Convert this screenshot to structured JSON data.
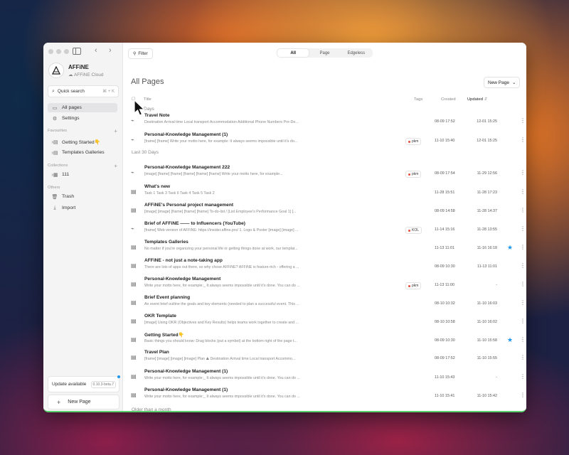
{
  "sidebar": {
    "workspace_name": "AFFiNE",
    "workspace_sub": "AFFiNE Cloud",
    "quick_search": "Quick search",
    "quick_search_kbd": "⌘ + K",
    "nav": [
      {
        "label": "All pages",
        "icon": "folder-icon"
      },
      {
        "label": "Settings",
        "icon": "gear-icon"
      }
    ],
    "favourites_label": "Favourites",
    "favourites": [
      "Getting Started👇",
      "Templates Galleries"
    ],
    "collections_label": "Collections",
    "collections": [
      "111"
    ],
    "others_label": "Others",
    "others": [
      {
        "label": "Trash",
        "icon": "trash-icon"
      },
      {
        "label": "Import",
        "icon": "import-icon"
      }
    ],
    "update_label": "Update available",
    "update_version": "0.10.3-beta.7",
    "new_page": "New Page"
  },
  "toolbar": {
    "filter": "Filter",
    "modes": [
      "All",
      "Page",
      "Edgeless"
    ],
    "active_mode": "All"
  },
  "main": {
    "title": "All Pages",
    "new_page_btn": "New Page",
    "columns": {
      "title": "Title",
      "tags": "Tags",
      "created": "Created",
      "updated": "Updated"
    },
    "groups": {
      "g1": "Days",
      "g2": "Last 30 Days",
      "g3": "Older than a month"
    },
    "rows": [
      {
        "title": "Travel Note",
        "preview": "Destination Arrival time Local transport Accommodation Additional Phone Numbers Pre-De...",
        "tag": "",
        "created": "08-09 17:52",
        "updated": "12-01 15:25",
        "fav": false,
        "icon": "edgeless-icon"
      },
      {
        "title": "Personal-Knowledge Management (1)",
        "preview": "[frame] [frame] Write your motto here, for example: It always seems impossible until it's do...",
        "tag": "pkm",
        "created": "11-10 15:40",
        "updated": "12-01 15:25",
        "fav": false,
        "icon": "edgeless-icon"
      },
      {
        "title": "Personal-Knowledge Management 222",
        "preview": "[image] [frame] [frame] [frame] [frame] [frame] Write your motto here, for example...",
        "tag": "pkm",
        "created": "08-09 17:54",
        "updated": "11-29 12:56",
        "fav": false,
        "icon": "edgeless-icon"
      },
      {
        "title": "What's new",
        "preview": "Task 1 Task 3 Task 6 Task 4 Task 5 Task 2",
        "tag": "",
        "created": "11-28 15:51",
        "updated": "11-28 17:23",
        "fav": false,
        "icon": "page-icon"
      },
      {
        "title": "AFFiNE's Personal project management",
        "preview": "[image] [image] [frame] [frame] [frame] To-do-list / [List Employee's Performance Goal 1] [...",
        "tag": "",
        "created": "08-09 14:58",
        "updated": "11-28 14:37",
        "fav": false,
        "icon": "page-icon"
      },
      {
        "title": "Brief of AFFiNE —— to Influencers (YouTube)",
        "preview": "[frame] Web version of AFFiNE: https://insider.affine.pro/ 1. Logo & Poster [image] [image] ...",
        "tag": "KOL",
        "created": "11-14 15:16",
        "updated": "11-28 13:55",
        "fav": false,
        "icon": "edgeless-icon"
      },
      {
        "title": "Templates Galleries",
        "preview": "No matter if you're organizing your personal life or getting things done at work, our templat...",
        "tag": "",
        "created": "11-13 11:01",
        "updated": "11-16 16:18",
        "fav": true,
        "icon": "page-icon"
      },
      {
        "title": "AFFiNE - not just a note-taking app",
        "preview": "There are lots of apps out there, so why chose AFFiNE? AFFiNE is feature-rich - offering a ...",
        "tag": "",
        "created": "08-09 10:30",
        "updated": "11-13 11:01",
        "fav": false,
        "icon": "page-icon"
      },
      {
        "title": "Personal-Knowledge Management",
        "preview": "Write your motto here, for example:_ It always seems impossible until it's done. You can do ...",
        "tag": "pkm",
        "created": "11-13 11:00",
        "updated": "-",
        "fav": false,
        "icon": "page-icon"
      },
      {
        "title": "Brief Event planning",
        "preview": "An event brief outline the goals and key elements (needed to plan a successful event. This ...",
        "tag": "",
        "created": "08-10 10:32",
        "updated": "11-10 16:03",
        "fav": false,
        "icon": "page-icon"
      },
      {
        "title": "OKR Template",
        "preview": "[image] Using OKR (Objectives and Key Results) helps teams work together to create and ...",
        "tag": "",
        "created": "08-10 10:58",
        "updated": "11-10 16:02",
        "fav": false,
        "icon": "page-icon"
      },
      {
        "title": "Getting Started👇",
        "preview": "Basic things you should know: Drag blocks (put a symbol) at the bottom right of the page t...",
        "tag": "",
        "created": "08-09 10:30",
        "updated": "11-10 15:58",
        "fav": true,
        "icon": "page-icon"
      },
      {
        "title": "Travel Plan",
        "preview": "[frame] [image] [image] [image] Plan ⛰ Destination Arrival time Local transport Accommo...",
        "tag": "",
        "created": "08-09 17:52",
        "updated": "11-10 15:55",
        "fav": false,
        "icon": "page-icon"
      },
      {
        "title": "Personal-Knowledge Management (1)",
        "preview": "Write your motto here, for example:_ It always seems impossible until it's done. You can do ...",
        "tag": "",
        "created": "11-10 15:43",
        "updated": "-",
        "fav": false,
        "icon": "page-icon"
      },
      {
        "title": "Personal-Knowledge Management (1)",
        "preview": "Write your motto here, for example:_ It always seems impossible until it's done. You can do ...",
        "tag": "",
        "created": "11-10 15:41",
        "updated": "11-10 15:42",
        "fav": false,
        "icon": "page-icon"
      }
    ]
  }
}
